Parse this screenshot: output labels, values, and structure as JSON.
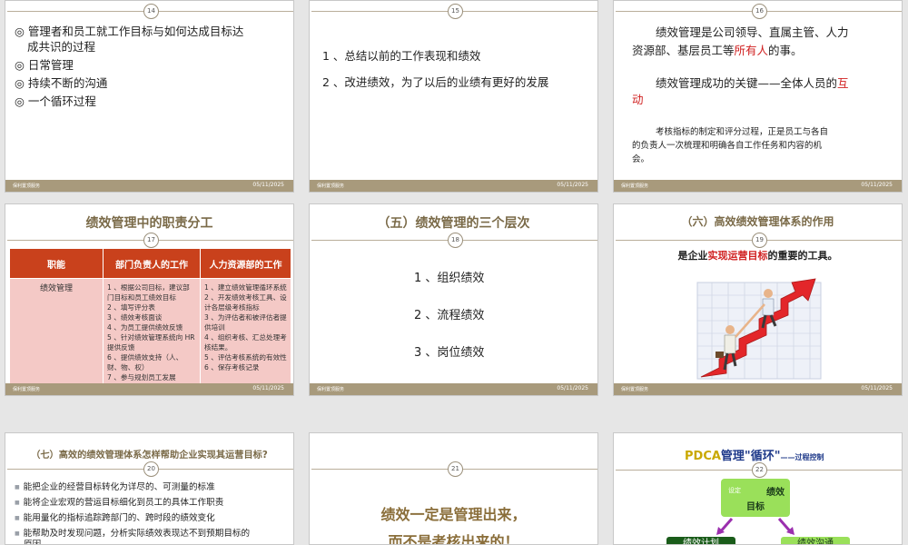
{
  "footer_left": "保利置顶服务",
  "footer_date": "05/11/2025",
  "s14": {
    "num": "14",
    "line1": "◎ 管理者和员工就工作目标与如何达成目标达",
    "line1b": "成共识的过程",
    "line2": "◎ 日常管理",
    "line3": "◎ 持续不断的沟通",
    "line4": "◎ 一个循环过程"
  },
  "s15": {
    "num": "15",
    "item1": "1 、总结以前的工作表现和绩效",
    "item2": "2 、改进绩效，为了以后的业绩有更好的发展"
  },
  "s16": {
    "num": "16",
    "p1a": "绩效管理是公司领导、直属主管、人力",
    "p1b": "资源部、基层员工等",
    "p1red": "所有人",
    "p1c": "的事。",
    "p2a": "绩效管理成功的关键——全体人员的",
    "p2red1": "互",
    "p2red2": "动",
    "p3a": "考核指标的制定和评分过程，正是员工与各自",
    "p3b": "的负责人一次梳理和明确各自工作任务和内容的机",
    "p3c": "会。"
  },
  "s17": {
    "num": "17",
    "title": "绩效管理中的职责分工",
    "headers": [
      "职能",
      "部门负责人的工作",
      "人力资源部的工作"
    ],
    "row_label": "绩效管理",
    "dept_items": [
      "1 、根据公司目标，建议部门目标和员工绩效目标",
      "2 、填写评分表",
      "3 、绩效考核面谈",
      "4 、为员工提供绩效反馈",
      "5 、针对绩效管理系统向 HR 提供反馈",
      "6 、提供绩效支持（人、财、物、权）",
      "7 、参与规划员工发展"
    ],
    "hr_items": [
      "1 、建立绩效管理循环系统",
      "2 、开发绩效考核工具、设计各层级考核指标",
      "3 、为评估者和被评估者提供培训",
      "4 、组织考核、汇总处理考核结果。",
      "5 、评估考核系统的有效性",
      "6 、保存考核记录"
    ]
  },
  "s18": {
    "num": "18",
    "title": "（五）绩效管理的三个层次",
    "items": [
      "1 、组织绩效",
      "2 、流程绩效",
      "3 、岗位绩效"
    ]
  },
  "s19": {
    "num": "19",
    "title": "（六）高效绩效管理体系的作用",
    "sub_a": "是企业",
    "sub_red": "实现运营目标",
    "sub_b": "的重要的工具。"
  },
  "s20": {
    "num": "20",
    "title": "（七）高效的绩效管理体系怎样帮助企业实现其运营目标?",
    "bullets": [
      "能把企业的经营目标转化为详尽的、可测量的标准",
      "能将企业宏观的营运目标细化到员工的具体工作职责",
      "能用量化的指标追踪跨部门的、跨时段的绩效变化",
      "能帮助及时发现问题，分析实际绩效表现达不到预期目标的",
      "原因"
    ]
  },
  "s21": {
    "num": "21",
    "line1": "绩效一定是管理出来，",
    "line2": "而不是考核出来的！"
  },
  "s22": {
    "num": "22",
    "title_a": "PDCA",
    "title_b": "管理\"循环\"",
    "title_c": "——过程控制",
    "box_small": "设定",
    "box_main1": "绩效",
    "box_main2": "目标",
    "box_left": "绩效计划",
    "box_right": "绩效沟通"
  }
}
